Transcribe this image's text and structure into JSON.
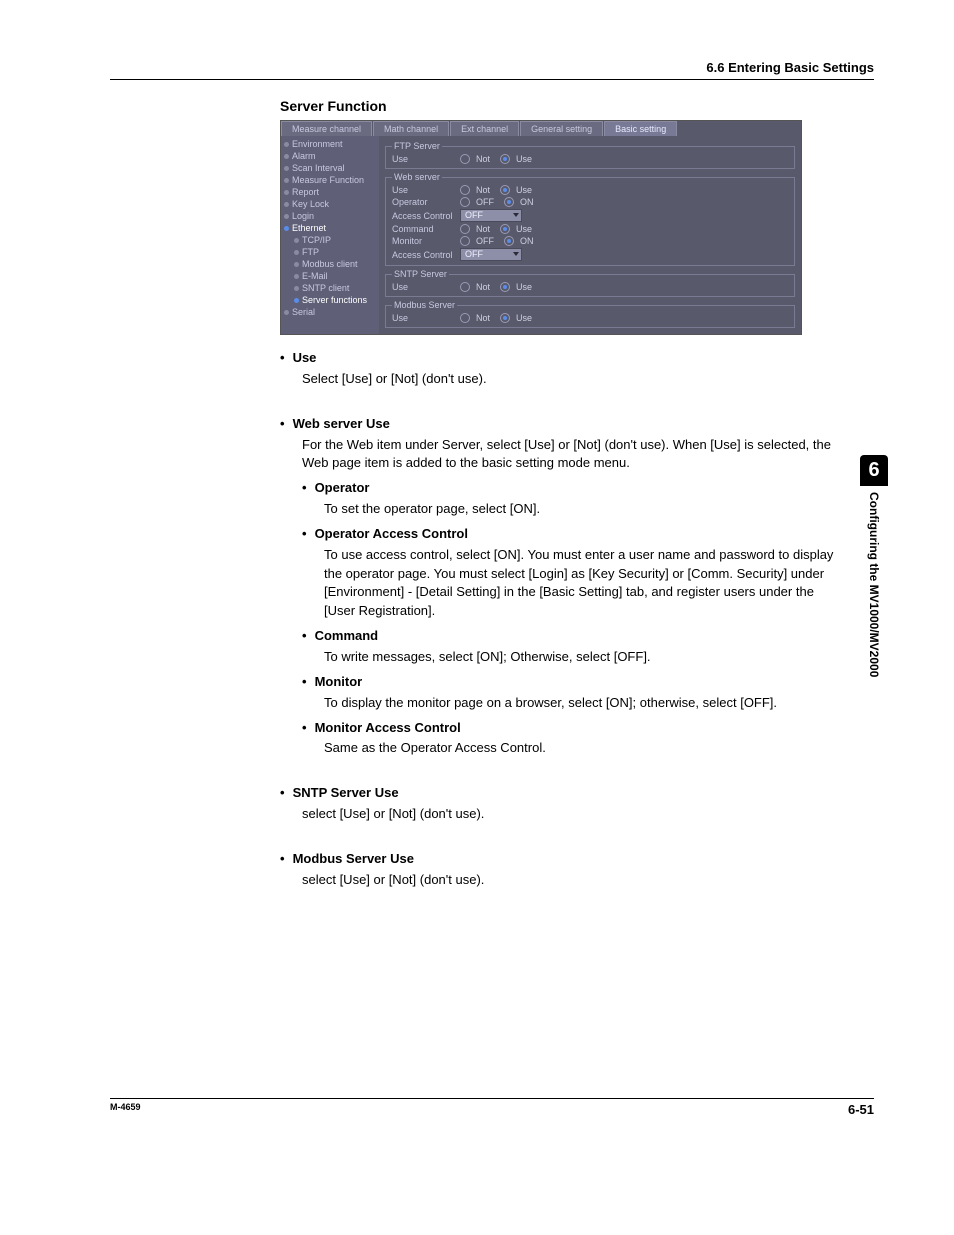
{
  "header": {
    "section": "6.6  Entering Basic Settings"
  },
  "section_title": "Server Function",
  "shot": {
    "tabs": [
      "Measure channel",
      "Math channel",
      "Ext channel",
      "General setting",
      "Basic setting"
    ],
    "active_tab": 4,
    "sidebar": [
      {
        "label": "Environment",
        "indent": false
      },
      {
        "label": "Alarm",
        "indent": false
      },
      {
        "label": "Scan Interval",
        "indent": false
      },
      {
        "label": "Measure Function",
        "indent": false
      },
      {
        "label": "Report",
        "indent": false
      },
      {
        "label": "Key Lock",
        "indent": false
      },
      {
        "label": "Login",
        "indent": false
      },
      {
        "label": "Ethernet",
        "indent": false,
        "sel": true
      },
      {
        "label": "TCP/IP",
        "indent": true
      },
      {
        "label": "FTP",
        "indent": true
      },
      {
        "label": "Modbus client",
        "indent": true
      },
      {
        "label": "E-Mail",
        "indent": true
      },
      {
        "label": "SNTP client",
        "indent": true
      },
      {
        "label": "Server functions",
        "indent": true,
        "sel": true
      },
      {
        "label": "Serial",
        "indent": false
      }
    ],
    "groups": {
      "ftp": {
        "legend": "FTP Server",
        "use": "Use",
        "opt1": "Not",
        "opt2": "Use"
      },
      "web": {
        "legend": "Web server",
        "r1": {
          "label": "Use",
          "opt1": "Not",
          "opt2": "Use"
        },
        "r2": {
          "label": "Operator",
          "opt1": "OFF",
          "opt2": "ON"
        },
        "r3": {
          "label": "Access Control",
          "val": "OFF"
        },
        "r4": {
          "label": "Command",
          "opt1": "Not",
          "opt2": "Use"
        },
        "r5": {
          "label": "Monitor",
          "opt1": "OFF",
          "opt2": "ON"
        },
        "r6": {
          "label": "Access Control",
          "val": "OFF"
        }
      },
      "sntp": {
        "legend": "SNTP Server",
        "use": "Use",
        "opt1": "Not",
        "opt2": "Use"
      },
      "modbus": {
        "legend": "Modbus Server",
        "use": "Use",
        "opt1": "Not",
        "opt2": "Use"
      }
    }
  },
  "content": {
    "use_h": "Use",
    "use_b": "Select [Use] or [Not] (don't use).",
    "web_h": "Web server Use",
    "web_b": "For the Web item under Server, select [Use] or [Not] (don't use).  When [Use] is selected, the Web page item is added to the basic setting mode menu.",
    "op_h": "Operator",
    "op_b": "To set the operator page, select [ON].",
    "oac_h": "Operator Access Control",
    "oac_b": "To use access control, select [ON].  You must enter a user name and password to display the operator page.  You must select [Login] as [Key Security] or [Comm. Security] under [Environment] - [Detail Setting] in the [Basic Setting] tab, and register users under the [User Registration].",
    "cmd_h": "Command",
    "cmd_b": "To write messages, select [ON]; Otherwise, select [OFF].",
    "mon_h": "Monitor",
    "mon_b": "To display the monitor page on a browser, select [ON]; otherwise, select [OFF].",
    "mac_h": "Monitor Access Control",
    "mac_b": "Same as the Operator Access Control.",
    "sntp_h": "SNTP Server Use",
    "sntp_b": "select [Use] or [Not] (don't use).",
    "mod_h": "Modbus Server Use",
    "mod_b": "select [Use] or [Not] (don't use)."
  },
  "side": {
    "num": "6",
    "text": "Configuring the MV1000/MV2000"
  },
  "footer": {
    "left": "M-4659",
    "right": "6-51"
  }
}
